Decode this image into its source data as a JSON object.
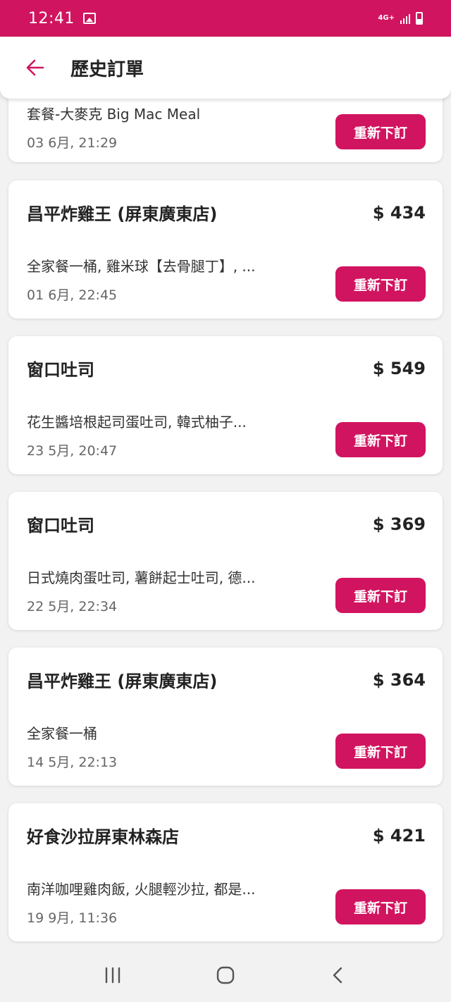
{
  "status_bar": {
    "time": "12:41",
    "network": "4G+"
  },
  "app_bar": {
    "title": "歷史訂單"
  },
  "orders": [
    {
      "store": "",
      "price": "",
      "items": "套餐-大麥克 Big Mac Meal",
      "date": "03 6月, 21:29",
      "button": "重新下訂"
    },
    {
      "store": "昌平炸雞王 (屏東廣東店)",
      "price": "$ 434",
      "items": "全家餐一桶, 雞米球【去骨腿丁】, ...",
      "date": "01 6月, 22:45",
      "button": "重新下訂"
    },
    {
      "store": "窗口吐司",
      "price": "$ 549",
      "items": "花生醬培根起司蛋吐司, 韓式柚子...",
      "date": "23 5月, 20:47",
      "button": "重新下訂"
    },
    {
      "store": "窗口吐司",
      "price": "$ 369",
      "items": "日式燒肉蛋吐司, 薯餅起士吐司, 德...",
      "date": "22 5月, 22:34",
      "button": "重新下訂"
    },
    {
      "store": "昌平炸雞王 (屏東廣東店)",
      "price": "$ 364",
      "items": "全家餐一桶",
      "date": "14 5月, 22:13",
      "button": "重新下訂"
    },
    {
      "store": "好食沙拉屏東林森店",
      "price": "$ 421",
      "items": "南洋咖哩雞肉飯, 火腿輕沙拉, 都是...",
      "date": "19 9月, 11:36",
      "button": "重新下訂"
    }
  ],
  "colors": {
    "accent": "#d1145f",
    "background": "#f2f2f2",
    "card": "#ffffff"
  },
  "icons": {
    "back": "arrow-left-icon",
    "gallery": "image-icon",
    "signal": "signal-icon",
    "battery": "battery-icon",
    "nav_recent": "recent-apps-icon",
    "nav_home": "home-icon",
    "nav_back": "chevron-left-icon"
  }
}
